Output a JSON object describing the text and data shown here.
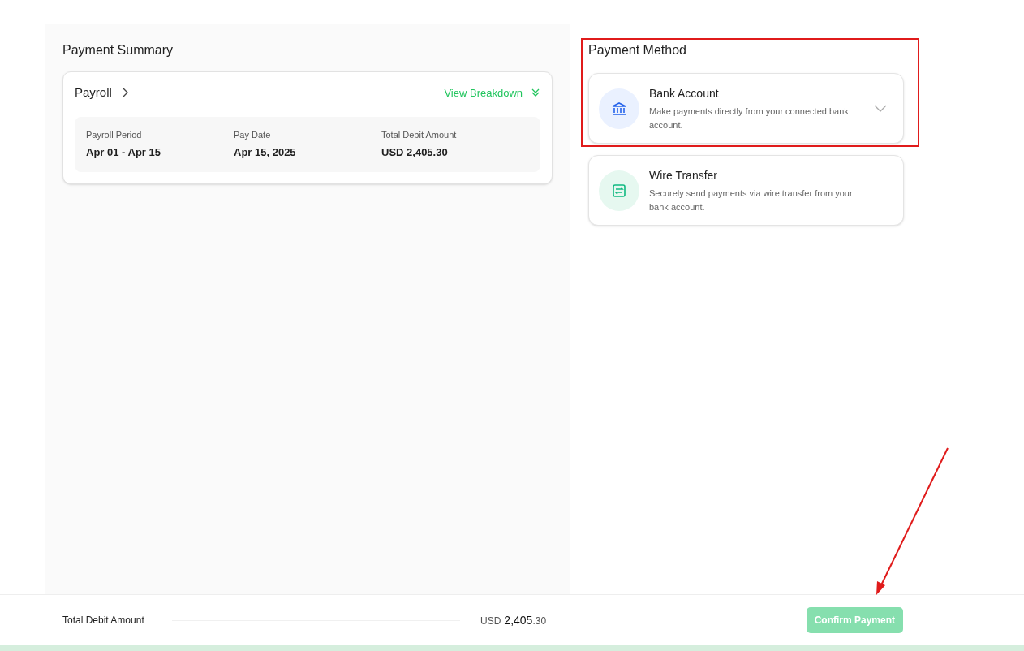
{
  "payment_summary": {
    "title": "Payment Summary",
    "card": {
      "title": "Payroll",
      "action": "View Breakdown",
      "expanded": false,
      "fields": [
        {
          "label": "Payroll Period",
          "value": "Apr 01 - Apr 15"
        },
        {
          "label": "Pay Date",
          "value": "Apr 15, 2025"
        },
        {
          "label": "Total Debit Amount",
          "value": "USD 2,405.30"
        }
      ]
    }
  },
  "payment_method": {
    "title": "Payment Method",
    "options": [
      {
        "kind": "bank",
        "title": "Bank Account",
        "description": "Make payments directly from your connected bank account.",
        "expandable": true
      },
      {
        "kind": "wire",
        "title": "Wire Transfer",
        "description": "Securely send payments via wire transfer from your bank account.",
        "expandable": false
      }
    ]
  },
  "footer": {
    "label": "Total Debit Amount",
    "currency": "USD",
    "amount_whole": "2,405",
    "amount_fraction": ".30",
    "button": {
      "label": "Confirm Payment",
      "disabled": true
    }
  }
}
